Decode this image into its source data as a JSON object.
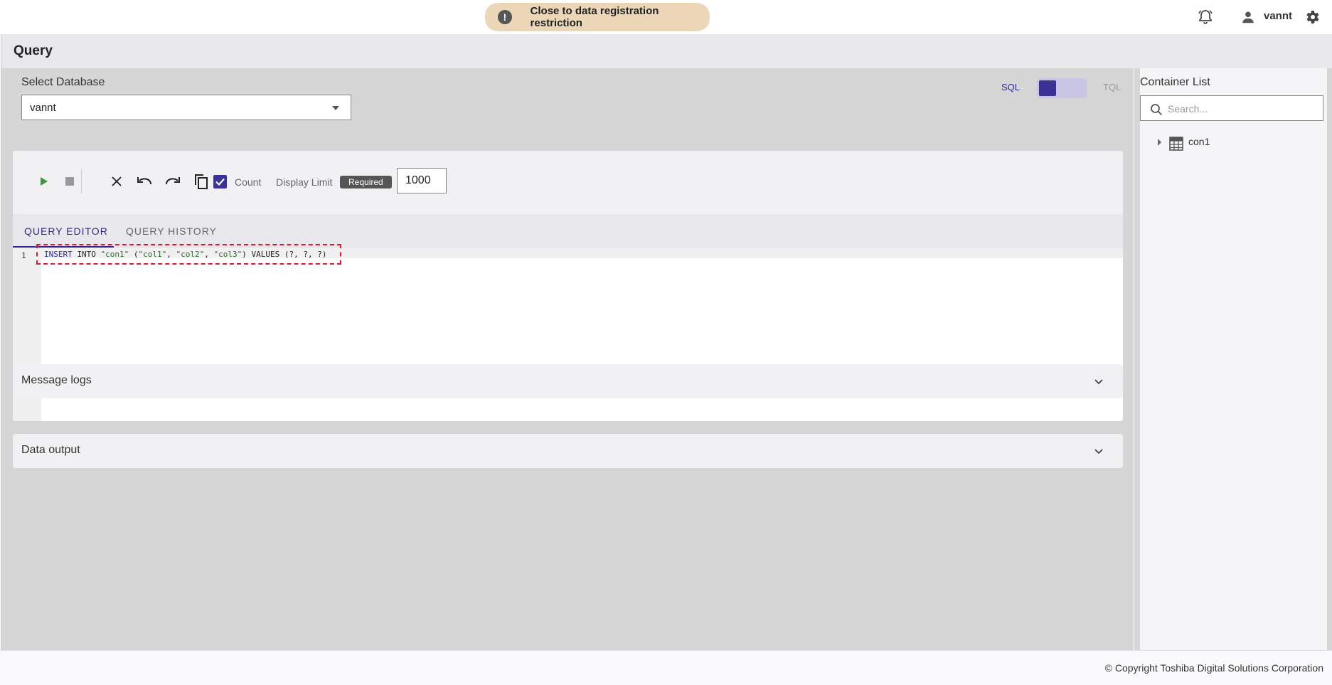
{
  "banner": {
    "text": "Close to data registration restriction",
    "icon": "!"
  },
  "header": {
    "user_name": "vannt"
  },
  "page": {
    "title": "Query"
  },
  "database": {
    "label": "Select Database",
    "selected": "vannt"
  },
  "mode": {
    "sql_label": "SQL",
    "tql_label": "TQL",
    "active": "SQL"
  },
  "toolbar": {
    "count_label": "Count",
    "count_checked": true,
    "display_limit_label": "Display Limit",
    "required_badge": "Required",
    "display_limit_value": "1000"
  },
  "tabs": [
    {
      "label": "QUERY EDITOR",
      "active": true
    },
    {
      "label": "QUERY HISTORY",
      "active": false
    }
  ],
  "editor": {
    "line_number": "1",
    "code": {
      "kw_insert": "INSERT",
      "t1": " INTO ",
      "s_table": "\"con1\"",
      "t2": " (",
      "s_col1": "\"col1\"",
      "t3": ", ",
      "s_col2": "\"col2\"",
      "t4": ", ",
      "s_col3": "\"col3\"",
      "t5": ") VALUES (?, ?, ?)"
    }
  },
  "panels": {
    "message_logs": "Message logs",
    "data_output": "Data output"
  },
  "container_list": {
    "title": "Container List",
    "search_placeholder": "Search...",
    "items": [
      {
        "label": "con1"
      }
    ]
  },
  "footer": {
    "copyright": "© Copyright Toshiba Digital Solutions Corporation"
  },
  "colors": {
    "accent": "#3a3296",
    "banner_bg": "#ecd6b8",
    "highlight": "#e0192d",
    "play": "#3a9a3a"
  }
}
